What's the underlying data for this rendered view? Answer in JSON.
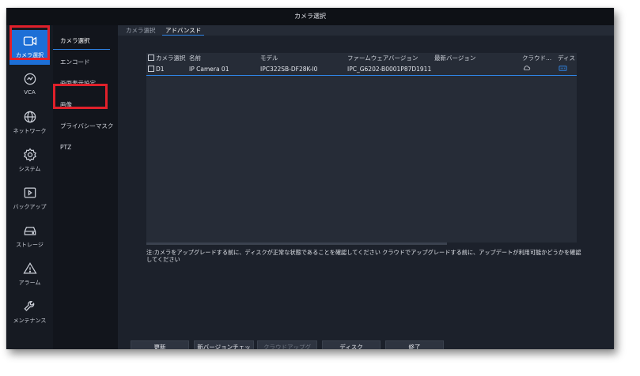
{
  "window": {
    "title": "カメラ選択"
  },
  "rail": {
    "items": [
      {
        "label": "カメラ選択",
        "icon": "camera-icon",
        "active": true
      },
      {
        "label": "VCA",
        "icon": "vca-icon"
      },
      {
        "label": "ネットワーク",
        "icon": "globe-icon"
      },
      {
        "label": "システム",
        "icon": "gear-icon"
      },
      {
        "label": "バックアップ",
        "icon": "backup-icon"
      },
      {
        "label": "ストレージ",
        "icon": "storage-icon"
      },
      {
        "label": "アラーム",
        "icon": "alarm-icon"
      },
      {
        "label": "メンテナンス",
        "icon": "wrench-icon"
      }
    ]
  },
  "submenu": {
    "items": [
      {
        "label": "カメラ選択",
        "active": true
      },
      {
        "label": "エンコード"
      },
      {
        "label": "画面表示設定"
      },
      {
        "label": "画像"
      },
      {
        "label": "プライバシーマスク"
      },
      {
        "label": "PTZ"
      }
    ]
  },
  "tabs": [
    {
      "label": "カメラ選択"
    },
    {
      "label": "アドバンスド",
      "active": true
    }
  ],
  "table": {
    "columns": [
      "カメラ選択",
      "名前",
      "モデル",
      "ファームウェアバージョン",
      "最新バージョン",
      "クラウド...",
      "ディス"
    ],
    "rows": [
      {
        "id": "D1",
        "name": "IP Camera 01",
        "model": "IPC322SB-DF28K-I0",
        "firmware": "IPC_G6202-B0001P87D1911",
        "latest": "",
        "cloud_icon": "cloud-icon",
        "disk_icon": "disk-icon"
      }
    ]
  },
  "note": "注:カメラをアップグレードする前に、ディスクが正常な状態であることを確認してください クラウドでアップグレードする前に、アップデートが利用可能かどうかを確認してください",
  "buttons": {
    "refresh": "更新",
    "check_version": "新バージョンチェック",
    "cloud_upgrade": "クラウドアップグレ...",
    "disk": "ディスク",
    "exit": "終了"
  },
  "colors": {
    "accent": "#1d6fd6",
    "highlight": "#e0202a",
    "background": "#161a22"
  }
}
